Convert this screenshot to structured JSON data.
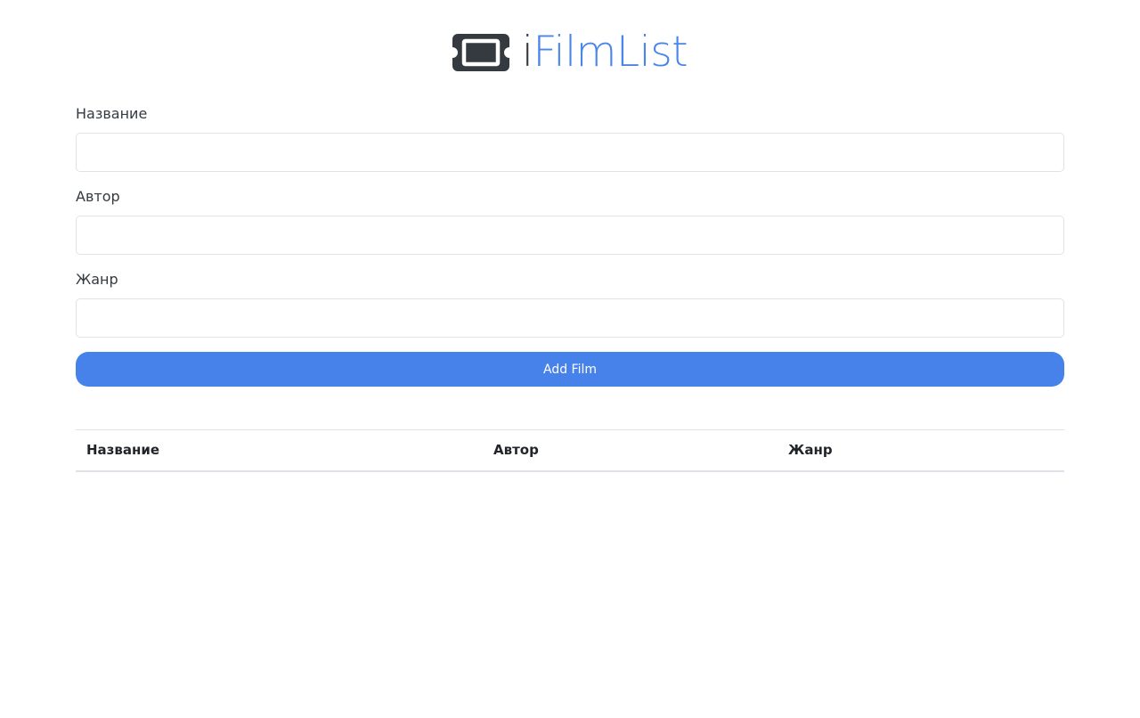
{
  "brand": {
    "logo_icon": "ticket-icon",
    "prefix": "i",
    "name": "FilmList",
    "colors": {
      "prefix": "#343a40",
      "name": "#4a86e8",
      "icon": "#343a40"
    }
  },
  "form": {
    "fields": [
      {
        "label": "Название",
        "value": "",
        "placeholder": ""
      },
      {
        "label": "Автор",
        "value": "",
        "placeholder": ""
      },
      {
        "label": "Жанр",
        "value": "",
        "placeholder": ""
      }
    ],
    "submit_label": "Add Film",
    "submit_color": "#4682ea"
  },
  "table": {
    "columns": [
      "Название",
      "Автор",
      "Жанр"
    ],
    "rows": []
  }
}
